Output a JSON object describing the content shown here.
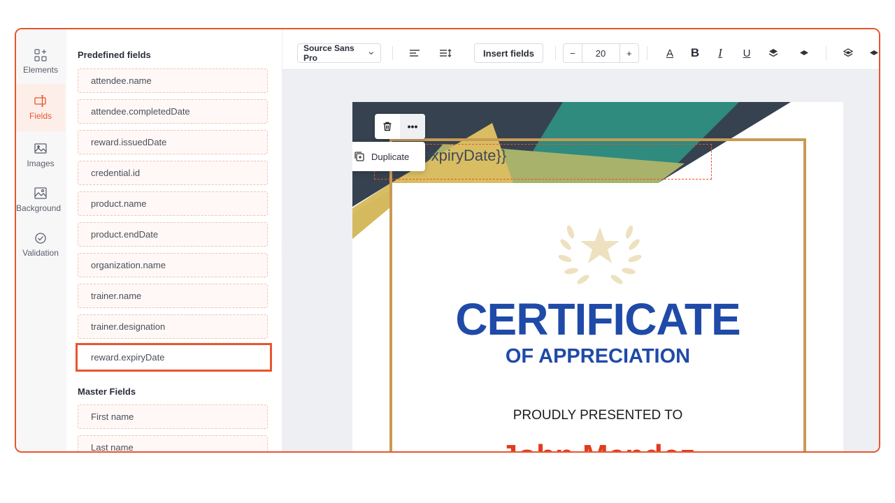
{
  "rail": {
    "items": [
      {
        "label": "Elements",
        "icon": "elements-icon"
      },
      {
        "label": "Fields",
        "icon": "fields-icon",
        "active": true
      },
      {
        "label": "Images",
        "icon": "image-icon"
      },
      {
        "label": "Background",
        "icon": "background-icon"
      },
      {
        "label": "Validation",
        "icon": "validation-icon"
      }
    ]
  },
  "panel": {
    "predefined_title": "Predefined fields",
    "predefined": [
      "attendee.name",
      "attendee.completedDate",
      "reward.issuedDate",
      "credential.id",
      "product.name",
      "product.endDate",
      "organization.name",
      "trainer.name",
      "trainer.designation",
      "reward.expiryDate"
    ],
    "master_title": "Master Fields",
    "master": [
      "First name",
      "Last name"
    ]
  },
  "toolbar": {
    "font": "Source Sans Pro",
    "insert_label": "Insert fields",
    "font_size": "20",
    "minus": "−",
    "plus": "+",
    "underline_a": "A",
    "bold": "B",
    "italic": "I",
    "underline": "U"
  },
  "canvas": {
    "selected_field_text": "d.expiryDate}}",
    "duplicate_label": "Duplicate",
    "more_label": "•••",
    "certificate": {
      "title": "CERTIFICATE",
      "subtitle": "OF APPRECIATION",
      "presented": "PROUDLY PRESENTED TO",
      "recipient": "John Mendez"
    }
  },
  "colors": {
    "accent": "#e8552e",
    "certificate_blue": "#1f4aa8",
    "gold": "#c89a55",
    "teal": "#2e8b7e",
    "slate": "#36424f"
  }
}
